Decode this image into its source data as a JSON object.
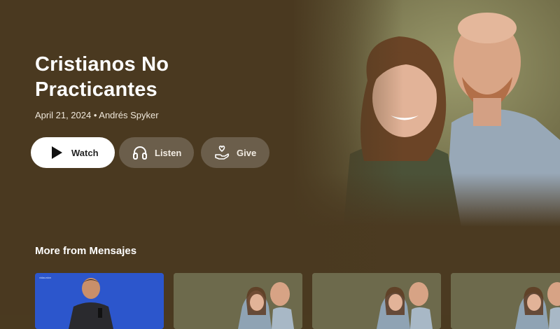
{
  "hero": {
    "title": "Cristianos No Practicantes",
    "meta": "April 21, 2024 • Andrés Spyker",
    "image_alt": "hero-couple-photo"
  },
  "actions": {
    "watch_label": "Watch",
    "listen_label": "Listen",
    "give_label": "Give"
  },
  "more": {
    "section_title": "More from Mensajes",
    "cards": [
      {
        "thumb": "preacher-on-stage-blue",
        "label": "vidaunion"
      },
      {
        "thumb": "couple-photo"
      },
      {
        "thumb": "couple-photo"
      },
      {
        "thumb": "couple-photo"
      }
    ]
  },
  "colors": {
    "background": "#4a3a20",
    "primary_button": "#ffffff",
    "secondary_button": "#6b5e4b",
    "live_card": "#2d55c9"
  }
}
